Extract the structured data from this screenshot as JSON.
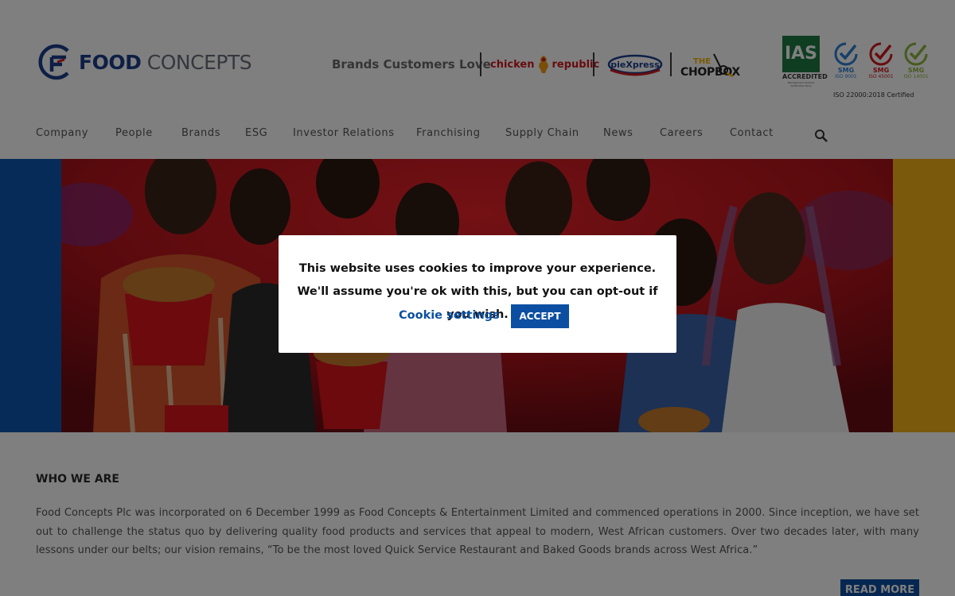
{
  "header": {
    "logo_word_1": "FOOD",
    "logo_word_2": "CONCEPTS",
    "brands_label": "Brands Customers Love",
    "brands": {
      "chicken_republic_word_1": "chicken",
      "chicken_republic_word_2": "republic",
      "piexpress": "pieXpress",
      "chopbox_line_1": "THE",
      "chopbox_line_2": "CHOPBOX"
    },
    "certifications": {
      "ias": "IAS",
      "ias_accredited": "ACCREDITED",
      "ias_subtext": "Management Systems Certification Body",
      "smg_name": "SMG",
      "iso_9001": "ISO 9001",
      "iso_45001": "ISO 45001",
      "iso_14001": "ISO 14001",
      "iso_22000": "ISO 22000:2018 Certified"
    },
    "brand_colors": {
      "primary_blue": "#1b3f8b",
      "accent_red": "#d0191f",
      "accent_yellow": "#f5b21b"
    }
  },
  "nav": {
    "items": [
      {
        "label": "Company"
      },
      {
        "label": "People"
      },
      {
        "label": "Brands"
      },
      {
        "label": "ESG"
      },
      {
        "label": "Investor Relations"
      },
      {
        "label": "Franchising"
      },
      {
        "label": "Supply Chain"
      },
      {
        "label": "News"
      },
      {
        "label": "Careers"
      },
      {
        "label": "Contact"
      }
    ],
    "search_icon": "search-icon"
  },
  "hero": {
    "left_band_color": "#0f56b3",
    "right_band_color": "#f5b21b",
    "photo_background": "#b3141b"
  },
  "who_we_are": {
    "heading": "WHO WE ARE",
    "body": "Food Concepts Plc was incorporated on 6 December 1999 as Food Concepts & Entertainment Limited and commenced operations in 2000. Since inception, we have set out to challenge the status quo by delivering quality food products and services that appeal to modern, West African customers. Over two decades later, with many lessons under our belts; our vision remains, “To be the most loved Quick Service Restaurant and Baked Goods brands across West Africa.”",
    "read_more_label": "READ MORE"
  },
  "cookie_banner": {
    "message": "This website uses cookies to improve your experience. We'll assume you're ok with this, but you can opt-out if you wish.",
    "settings_label": "Cookie settings",
    "accept_label": "ACCEPT",
    "accent_color": "#0c4fa2"
  }
}
